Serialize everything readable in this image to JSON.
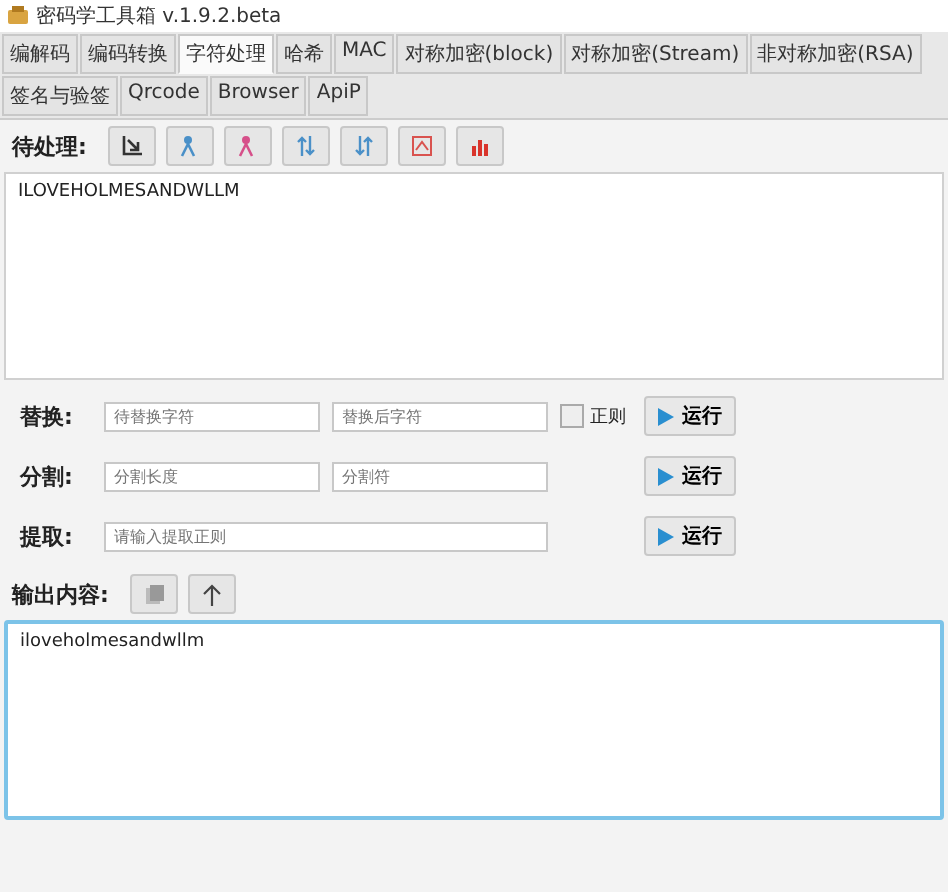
{
  "window": {
    "title": "密码学工具箱 v.1.9.2.beta"
  },
  "tabs": [
    {
      "label": "编解码",
      "selected": false
    },
    {
      "label": "编码转换",
      "selected": false
    },
    {
      "label": "字符处理",
      "selected": true
    },
    {
      "label": "哈希",
      "selected": false
    },
    {
      "label": "MAC",
      "selected": false
    },
    {
      "label": "对称加密(block)",
      "selected": false
    },
    {
      "label": "对称加密(Stream)",
      "selected": false
    },
    {
      "label": "非对称加密(RSA)",
      "selected": false
    },
    {
      "label": "签名与验签",
      "selected": false
    },
    {
      "label": "Qrcode",
      "selected": false
    },
    {
      "label": "Browser",
      "selected": false
    },
    {
      "label": "ApiP",
      "selected": false
    }
  ],
  "input": {
    "label": "待处理:",
    "value": "ILOVEHOLMESANDWLLM"
  },
  "operations": [
    {
      "label": "替换:",
      "fields": [
        {
          "placeholder": "待替换字符"
        },
        {
          "placeholder": "替换后字符"
        }
      ],
      "checkbox": {
        "label": "正则",
        "checked": false
      },
      "button": "运行"
    },
    {
      "label": "分割:",
      "fields": [
        {
          "placeholder": "分割长度"
        },
        {
          "placeholder": "分割符"
        }
      ],
      "button": "运行"
    },
    {
      "label": "提取:",
      "fields": [
        {
          "placeholder": "请输入提取正则"
        }
      ],
      "button": "运行"
    }
  ],
  "output": {
    "label": "输出内容:",
    "value": "iloveholmesandwllm"
  }
}
